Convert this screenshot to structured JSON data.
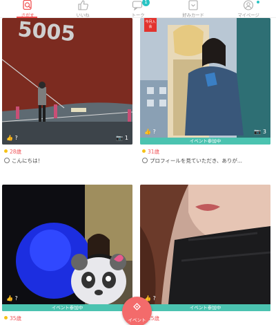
{
  "nav": {
    "items": [
      {
        "label": "さがす",
        "icon": "search-icon"
      },
      {
        "label": "いいね",
        "icon": "thumbs-up-icon"
      },
      {
        "label": "トーク",
        "icon": "chat-icon",
        "badge": "1"
      },
      {
        "label": "好みカード",
        "icon": "card-icon"
      },
      {
        "label": "マイページ",
        "icon": "user-icon"
      }
    ],
    "active_color": "#f04f4f",
    "badge_color": "#29c4c4"
  },
  "cards": [
    {
      "likes": "?",
      "photo_count": "1",
      "age": "28歳",
      "message": "こんにちは！",
      "online_color": "#f5c218"
    },
    {
      "likes": "?",
      "photo_count": "3",
      "age": "31歳",
      "message": "プロフィールを見ていただき、ありが...",
      "event": "イベント参加中",
      "new_badge": "今月入会",
      "online_color": "#f5c218"
    },
    {
      "likes": "?",
      "age": "35歳",
      "event": "イベント参加中",
      "online_color": "#f5c218"
    },
    {
      "likes": "?",
      "age": "25歳",
      "event": "イベント参加中",
      "online_color": "#f5c218"
    }
  ],
  "fab": {
    "label": "イベント"
  },
  "event_bar_color": "#4bc3b0"
}
